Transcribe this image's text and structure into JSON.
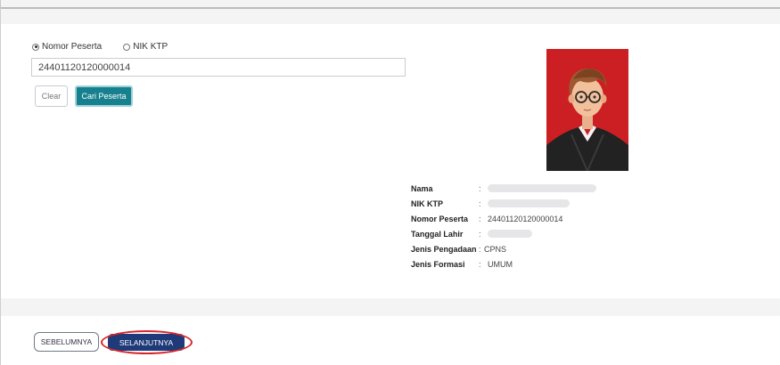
{
  "search": {
    "radio_options": [
      {
        "label": "Nomor Peserta",
        "selected": true
      },
      {
        "label": "NIK KTP",
        "selected": false
      }
    ],
    "input_value": "24401120120000014"
  },
  "buttons": {
    "clear": "Clear",
    "search": "Cari Peserta",
    "previous": "SEBELUMNYA",
    "next": "SELANJUTNYA"
  },
  "participant": {
    "fields": [
      {
        "label": "Nama",
        "value": "",
        "redacted": true
      },
      {
        "label": "NIK KTP",
        "value": "",
        "redacted": true
      },
      {
        "label": "Nomor Peserta",
        "value": "24401120120000014",
        "redacted": false
      },
      {
        "label": "Tanggal Lahir",
        "value": "",
        "redacted": true
      },
      {
        "label": "Jenis Pengadaan",
        "value": "CPNS",
        "redacted": false
      },
      {
        "label": "Jenis Formasi",
        "value": "UMUM",
        "redacted": false
      }
    ],
    "separator": ":"
  },
  "colors": {
    "search_button": "#17808f",
    "next_button": "#1e3a78",
    "photo_background": "#cc1f23",
    "highlight_circle": "#d8252a"
  }
}
